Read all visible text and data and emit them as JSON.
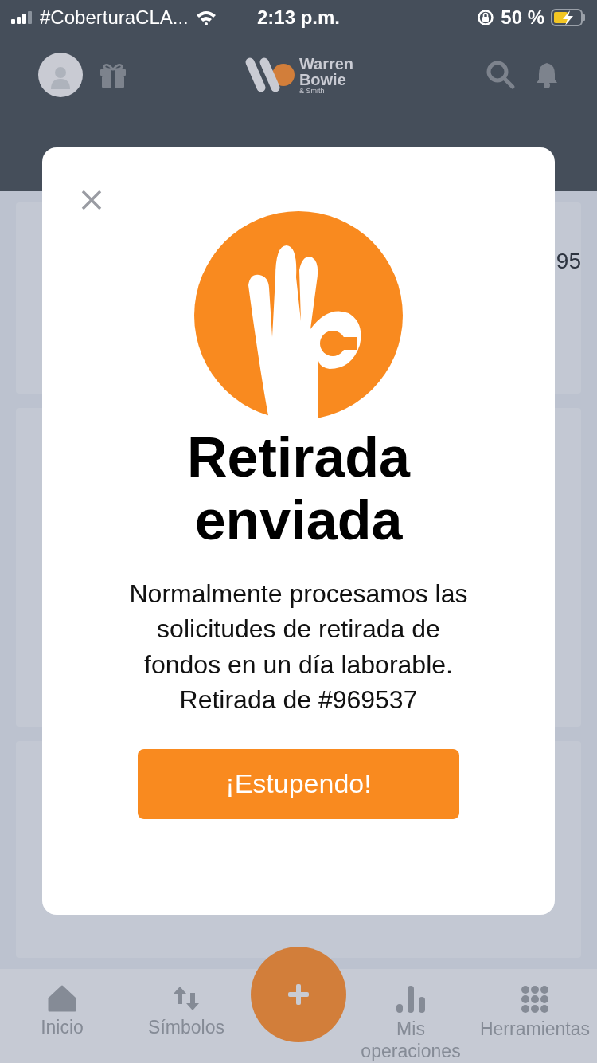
{
  "status_bar": {
    "carrier": "#CoberturaCLA...",
    "time": "2:13 p.m.",
    "battery": "50 %"
  },
  "header": {
    "brand": "Warren",
    "brand_line_2": "Bowie",
    "brand_sub": "& Smith"
  },
  "background_values": [
    "95"
  ],
  "modal": {
    "title": "Retirada enviada",
    "message": "Normalmente procesamos las solicitudes de retirada de fondos en un día laborable. Retirada de #969537",
    "button": "¡Estupendo!"
  },
  "bottom_nav": [
    {
      "kind": "home",
      "label": "Inicio"
    },
    {
      "kind": "swap",
      "label": "Símbolos"
    },
    {
      "kind": "plus"
    },
    {
      "kind": "bars",
      "label": "Mis operaciones"
    },
    {
      "kind": "grid",
      "label": "Herramientas"
    }
  ]
}
